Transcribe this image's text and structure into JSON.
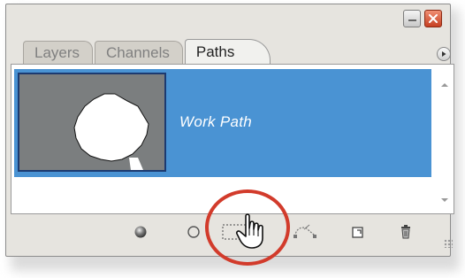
{
  "panel": {
    "tabs": [
      {
        "label": "Layers",
        "active": false
      },
      {
        "label": "Channels",
        "active": false
      },
      {
        "label": "Paths",
        "active": true
      }
    ],
    "paths": [
      {
        "name": "Work Path",
        "selected": true
      }
    ]
  },
  "toolbar": {
    "buttons": [
      {
        "name": "fill-path",
        "icon": "filled-circle-icon"
      },
      {
        "name": "stroke-path",
        "icon": "hollow-circle-icon"
      },
      {
        "name": "load-path-as-selection",
        "icon": "dashed-selection-icon"
      },
      {
        "name": "make-work-path",
        "icon": "work-path-icon"
      },
      {
        "name": "create-new-path",
        "icon": "new-page-icon"
      },
      {
        "name": "delete-path",
        "icon": "trash-icon"
      }
    ]
  },
  "colors": {
    "selection": "#4a93d3",
    "panel_bg": "#e6e4df",
    "highlight": "#d23b2b",
    "close_button": "#d4573a"
  }
}
